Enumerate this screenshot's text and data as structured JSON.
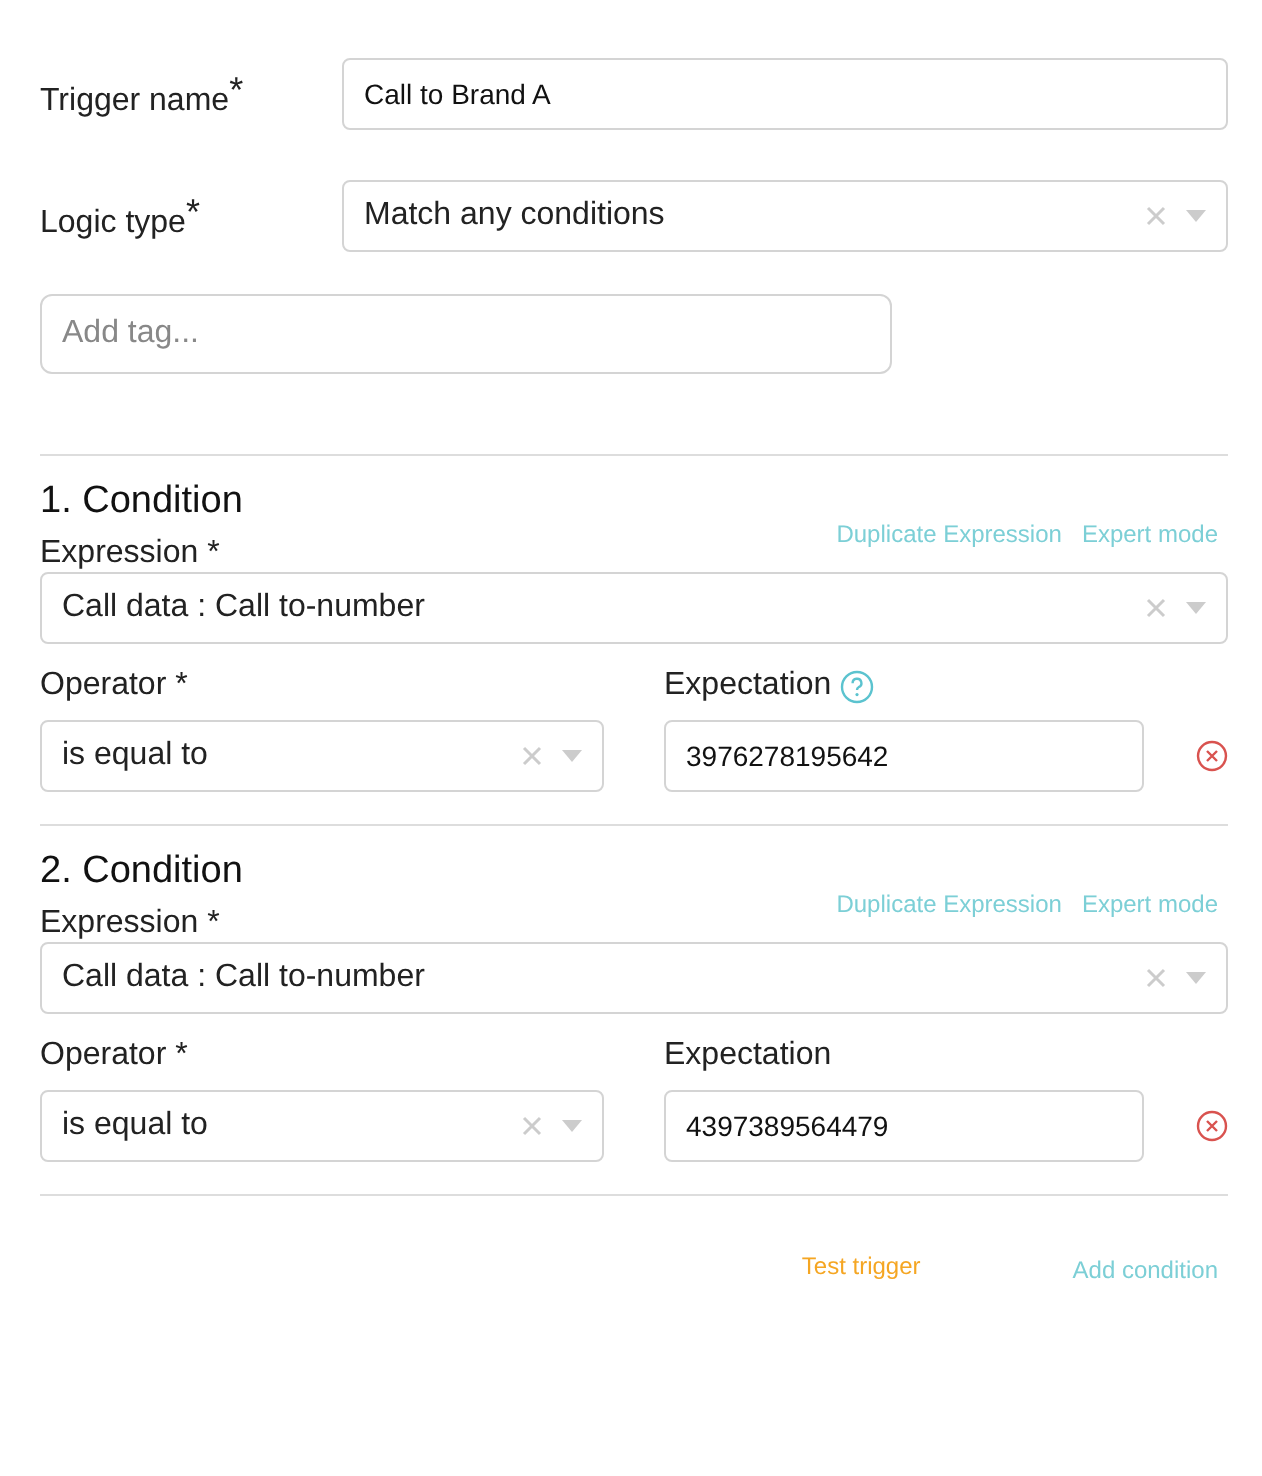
{
  "trigger_name": {
    "label": "Trigger name",
    "required_mark": "*",
    "value": "Call to Brand A"
  },
  "logic_type": {
    "label": "Logic type",
    "required_mark": "*",
    "value": "Match any conditions"
  },
  "tag_field": {
    "placeholder": "Add tag..."
  },
  "conditions": [
    {
      "title": "1. Condition",
      "duplicate_link": "Duplicate Expression",
      "expert_link": "Expert mode",
      "expression_label": "Expression *",
      "expression": "Call data : Call to-number",
      "operator_label": "Operator *",
      "operator": "is equal to",
      "expectation_label": "Expectation",
      "expectation_help": true,
      "expectation": "3976278195642"
    },
    {
      "title": "2. Condition",
      "duplicate_link": "Duplicate Expression",
      "expert_link": "Expert mode",
      "expression_label": "Expression *",
      "expression": "Call data : Call to-number",
      "operator_label": "Operator *",
      "operator": "is equal to",
      "expectation_label": "Expectation",
      "expectation_help": false,
      "expectation": "4397389564479"
    }
  ],
  "footer": {
    "test_button": "Test trigger",
    "add_button": "Add condition"
  }
}
